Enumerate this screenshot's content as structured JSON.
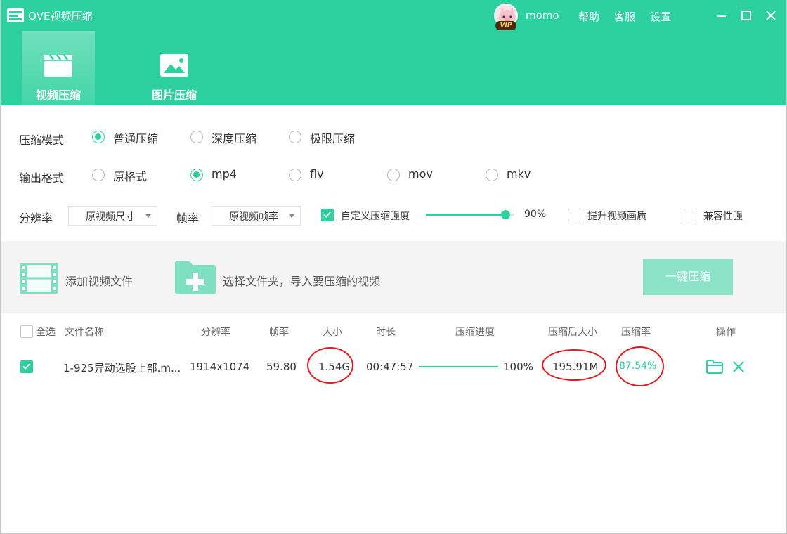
{
  "app": {
    "title": "QVE视频压缩"
  },
  "user": {
    "name": "momo",
    "badge": "VIP"
  },
  "top_links": {
    "help": "帮助",
    "service": "客服",
    "settings": "设置"
  },
  "nav": {
    "video": "视频压缩",
    "image": "图片压缩"
  },
  "settings": {
    "mode_label": "压缩模式",
    "modes": [
      "普通压缩",
      "深度压缩",
      "极限压缩"
    ],
    "format_label": "输出格式",
    "formats": [
      "原格式",
      "mp4",
      "flv",
      "mov",
      "mkv"
    ],
    "resolution_label": "分辨率",
    "resolution_value": "原视频尺寸",
    "framerate_label": "帧率",
    "framerate_value": "原视频帧率",
    "custom_strength_label": "自定义压缩强度",
    "custom_strength_checked": true,
    "strength_value": "90%",
    "strength_fraction": 0.9,
    "enhance_label": "提升视频画质",
    "compat_label": "兼容性强"
  },
  "toolbar": {
    "add_file": "添加视频文件",
    "add_folder": "选择文件夹，导入要压缩的视频",
    "compress": "一键压缩"
  },
  "table": {
    "headers": {
      "select_all": "全选",
      "name": "文件名称",
      "resolution": "分辨率",
      "framerate": "帧率",
      "size": "大小",
      "duration": "时长",
      "progress": "压缩进度",
      "after_size": "压缩后大小",
      "ratio": "压缩率",
      "actions": "操作"
    },
    "rows": [
      {
        "name": "1-925异动选股上部.m...",
        "resolution": "1914x1074",
        "framerate": "59.80",
        "size": "1.54G",
        "duration": "00:47:57",
        "progress": "100%",
        "after_size": "195.91M",
        "ratio": "87.54%"
      }
    ]
  },
  "colors": {
    "brand": "#2dd09f",
    "highlight_ring": "#e21b22",
    "button_disabled": "#8de3c7"
  }
}
